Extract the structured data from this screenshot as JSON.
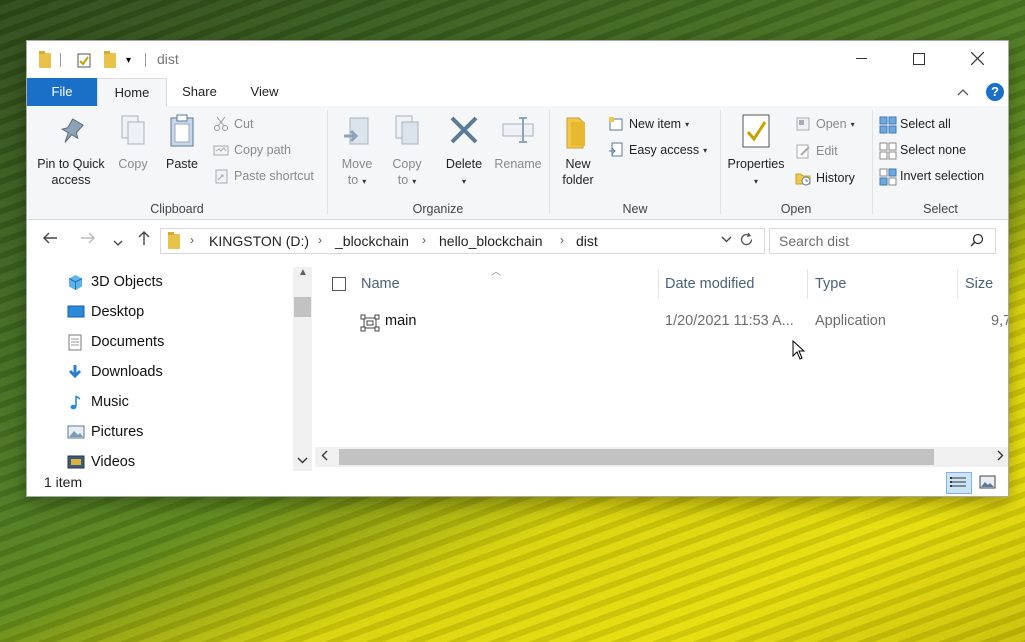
{
  "window": {
    "title": "dist",
    "colors": {
      "accent": "#1a6fc6",
      "column_header": "#4c607a"
    }
  },
  "tabs": {
    "file": "File",
    "home": "Home",
    "share": "Share",
    "view": "View",
    "help": "?"
  },
  "ribbon": {
    "clipboard": {
      "label": "Clipboard",
      "pin_to_quick_access": "Pin to Quick access",
      "pin_line1": "Pin to Quick",
      "pin_line2": "access",
      "copy": "Copy",
      "paste": "Paste",
      "cut": "Cut",
      "copy_path": "Copy path",
      "paste_shortcut": "Paste shortcut"
    },
    "organize": {
      "label": "Organize",
      "move_to_1": "Move",
      "move_to_2": "to",
      "copy_to_1": "Copy",
      "copy_to_2": "to",
      "delete": "Delete",
      "rename": "Rename"
    },
    "new": {
      "label": "New",
      "new_folder_1": "New",
      "new_folder_2": "folder",
      "new_item": "New item",
      "easy_access": "Easy access"
    },
    "open": {
      "label": "Open",
      "properties": "Properties",
      "open": "Open",
      "edit": "Edit",
      "history": "History"
    },
    "select": {
      "label": "Select",
      "select_all": "Select all",
      "select_none": "Select none",
      "invert_selection": "Invert selection"
    }
  },
  "address": {
    "breadcrumbs": [
      "KINGSTON (D:)",
      "_blockchain",
      "hello_blockchain",
      "dist"
    ],
    "search_placeholder": "Search dist"
  },
  "navpane": {
    "items": [
      {
        "label": "3D Objects",
        "icon": "3d-objects-icon"
      },
      {
        "label": "Desktop",
        "icon": "desktop-icon"
      },
      {
        "label": "Documents",
        "icon": "documents-icon"
      },
      {
        "label": "Downloads",
        "icon": "downloads-icon"
      },
      {
        "label": "Music",
        "icon": "music-icon"
      },
      {
        "label": "Pictures",
        "icon": "pictures-icon"
      },
      {
        "label": "Videos",
        "icon": "videos-icon"
      }
    ]
  },
  "columns": {
    "name": "Name",
    "date_modified": "Date modified",
    "type": "Type",
    "size": "Size"
  },
  "files": [
    {
      "name": "main",
      "date_modified": "1/20/2021 11:53 A...",
      "type": "Application",
      "size": "9,7",
      "icon": "application-icon"
    }
  ],
  "status": {
    "item_count": "1 item"
  }
}
